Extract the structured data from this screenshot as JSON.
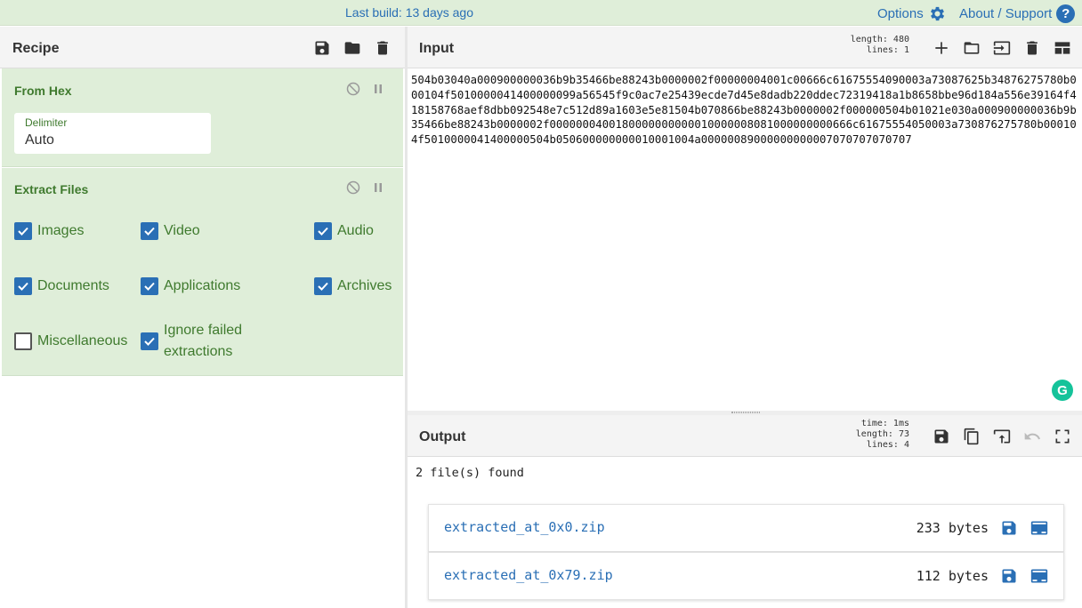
{
  "banner": {
    "last_build": "Last build: 13 days ago",
    "options": "Options",
    "about": "About / Support"
  },
  "recipe": {
    "title": "Recipe",
    "operations": [
      {
        "name": "From Hex",
        "delimiter_label": "Delimiter",
        "delimiter_value": "Auto"
      },
      {
        "name": "Extract Files",
        "checkboxes": [
          {
            "label": "Images",
            "checked": true
          },
          {
            "label": "Video",
            "checked": true
          },
          {
            "label": "Audio",
            "checked": true
          },
          {
            "label": "Documents",
            "checked": true
          },
          {
            "label": "Applications",
            "checked": true
          },
          {
            "label": "Archives",
            "checked": true
          },
          {
            "label": "Miscellaneous",
            "checked": false
          },
          {
            "label": "Ignore failed extractions",
            "checked": true
          }
        ]
      }
    ]
  },
  "input": {
    "title": "Input",
    "length_line": "length: 480",
    "lines_line": "lines:   1",
    "text": "504b03040a000900000036b9b35466be88243b0000002f00000004001c00666c61675554090003a73087625b34876275780b000104f5010000041400000099a56545f9c0ac7e25439ecde7d45e8dadb220ddec72319418a1b8658bbe96d184a556e39164f418158768aef8dbb092548e7c512d89a1603e5e81504b070866be88243b0000002f000000504b01021e030a000900000036b9b35466be88243b0000002f0000000400180000000000010000008081000000000666c61675554050003a730876275780b000104f5010000041400000504b050600000000010001004a00000089000000000007070707070707"
  },
  "output": {
    "title": "Output",
    "time_line": "time:  1ms",
    "length_line": "length:  73",
    "lines_line": "lines:   4",
    "found": "2 file(s) found",
    "files": [
      {
        "name": "extracted_at_0x0.zip",
        "size": "233 bytes"
      },
      {
        "name": "extracted_at_0x79.zip",
        "size": "112 bytes"
      }
    ]
  },
  "icons": {
    "gear": "gear-icon",
    "help": "help-icon",
    "save": "save-icon",
    "folder": "folder-icon",
    "trash": "trash-icon"
  },
  "colors": {
    "accent": "#2a6fb5",
    "op_bg": "#dfeed9",
    "op_text": "#3f7a2e"
  }
}
